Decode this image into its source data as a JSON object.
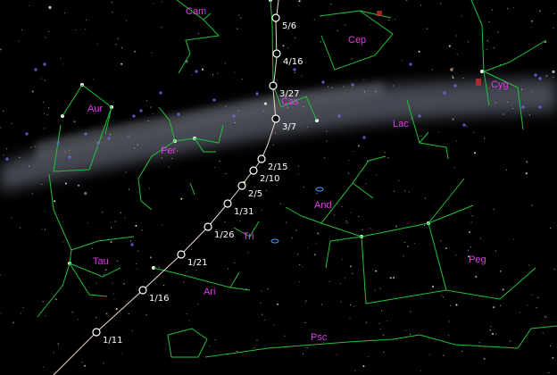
{
  "colors": {
    "background": "#000000",
    "constellation_lines": "#22c03a",
    "constellation_labels": "#e23ae8",
    "comet_path": "#f0d8c8",
    "date_markers": "#ffffff",
    "date_labels": "#ffffff",
    "milky_way": "#8a8fa0",
    "galaxy_markers": "#6e6cf0",
    "nebula_markers": "#c03030"
  },
  "constellations": [
    "Cam",
    "Cep",
    "Cyg",
    "Lac",
    "Cas",
    "Aur",
    "Per",
    "And",
    "Tri",
    "Tau",
    "Peg",
    "Ari",
    "Psc"
  ],
  "comet_path_dates": [
    "5/6",
    "4/16",
    "3/27",
    "3/7",
    "2/15",
    "2/10",
    "2/5",
    "1/31",
    "1/26",
    "1/21",
    "1/16",
    "1/11"
  ],
  "icons": [
    "date-marker-icon",
    "galaxy-icon",
    "nebula-icon"
  ]
}
